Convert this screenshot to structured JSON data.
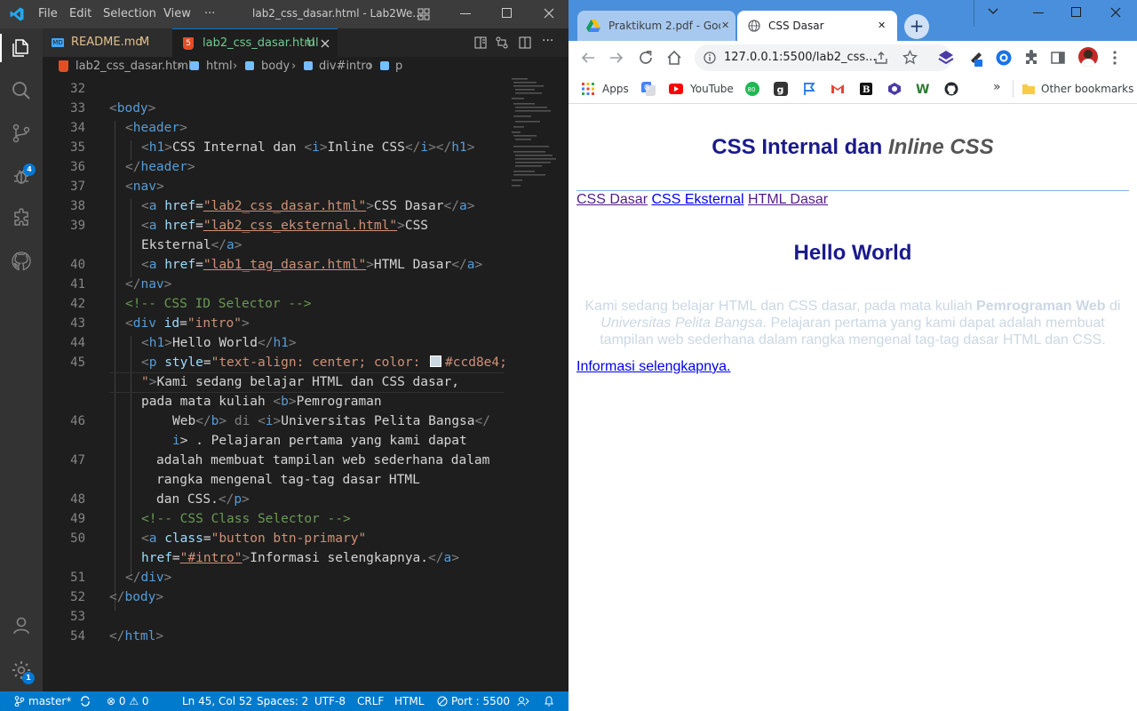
{
  "vscode": {
    "menu": [
      "File",
      "Edit",
      "Selection",
      "View",
      "···"
    ],
    "window_title": "lab2_css_dasar.html - Lab2We...",
    "tabs": [
      {
        "icon_text": "MD",
        "label": "README.md",
        "status": "M"
      },
      {
        "icon_text": "5",
        "label": "lab2_css_dasar.html",
        "status": "U"
      }
    ],
    "breadcrumb": [
      "lab2_css_dasar.html",
      "html",
      "body",
      "div#intro",
      "p"
    ],
    "line_numbers": [
      "32",
      "33",
      "34",
      "35",
      "36",
      "37",
      "38",
      "39",
      "40",
      "41",
      "42",
      "43",
      "44",
      "45",
      "46",
      "47",
      "48",
      "49",
      "50",
      "51",
      "52",
      "53",
      "54"
    ],
    "code": {
      "l33": [
        "<",
        "body",
        ">"
      ],
      "l34": [
        "<",
        "header",
        ">"
      ],
      "l35": [
        "<",
        "h1",
        ">",
        "CSS Internal dan ",
        "<",
        "i",
        ">",
        "Inline CSS",
        "</",
        "i",
        ">",
        "</",
        "h1",
        ">"
      ],
      "l36": [
        "</",
        "header",
        ">"
      ],
      "l37": [
        "<",
        "nav",
        ">"
      ],
      "l38": [
        "<",
        "a",
        " href",
        "=",
        "\"lab2_css_dasar.html\"",
        ">",
        "CSS Dasar",
        "</",
        "a",
        ">"
      ],
      "l39a": [
        "<",
        "a",
        " href",
        "=",
        "\"lab2_css_eksternal.html\"",
        ">",
        "CSS"
      ],
      "l39b": [
        "Eksternal",
        "</",
        "a",
        ">"
      ],
      "l40": [
        "<",
        "a",
        " href",
        "=",
        "\"lab1_tag_dasar.html\"",
        ">",
        "HTML Dasar",
        "</",
        "a",
        ">"
      ],
      "l41": [
        "</",
        "nav",
        ">"
      ],
      "l42": [
        "<!-- CSS ID Selector -->"
      ],
      "l43": [
        "<",
        "div",
        " id",
        "=",
        "\"intro\"",
        ">"
      ],
      "l44": [
        "<",
        "h1",
        ">",
        "Hello World",
        "</",
        "h1",
        ">"
      ],
      "l45a": [
        "<",
        "p",
        " style",
        "=",
        "\"text-align: center; color: ",
        "#ccd8e4;"
      ],
      "l45b": [
        "\"",
        ">",
        "Kami sedang belajar HTML dan CSS dasar,"
      ],
      "l45c": [
        "pada mata kuliah ",
        "<",
        "b",
        ">",
        "Pemrograman"
      ],
      "l46a": [
        "Web",
        "</",
        "b",
        "> di ",
        "<",
        "i",
        ">",
        "Universitas Pelita Bangsa",
        "</"
      ],
      "l46b": [
        "i",
        "> . Pelajaran pertama yang kami dapat"
      ],
      "l47a": [
        "adalah membuat tampilan web sederhana dalam"
      ],
      "l47b": [
        "rangka mengenal tag-tag dasar HTML"
      ],
      "l48": [
        "dan CSS.",
        "</",
        "p",
        ">"
      ],
      "l49": [
        "<!-- CSS Class Selector -->"
      ],
      "l50a": [
        "<",
        "a",
        " class",
        "=",
        "\"button btn-primary\""
      ],
      "l50b": [
        "href",
        "=",
        "\"#intro\"",
        ">",
        "Informasi selengkapnya.",
        "</",
        "a",
        ">"
      ],
      "l51": [
        "</",
        "div",
        ">"
      ],
      "l52": [
        "</",
        "body",
        ">"
      ],
      "l54": [
        "</",
        "html",
        ">"
      ]
    },
    "activity_badges": {
      "source_control": "4",
      "settings": "1"
    },
    "status": {
      "branch": "master*",
      "problems": "⊗ 0 ⚠ 0",
      "position": "Ln 45, Col 52",
      "spaces": "Spaces: 2",
      "encoding": "UTF-8",
      "eol": "CRLF",
      "language": "HTML",
      "port": "Port : 5500"
    },
    "swatch_color": "#ccd8e4"
  },
  "chrome": {
    "tabs": [
      {
        "label": "Praktikum 2.pdf - Goo",
        "close": "✕"
      },
      {
        "label": "CSS Dasar",
        "close": "✕"
      }
    ],
    "new_tab": "+",
    "url": "127.0.0.1:5500/lab2_css...",
    "bookmarks": [
      "Apps",
      "YouTube",
      "Other bookmarks"
    ],
    "bookmark_more": "»",
    "page": {
      "h1_plain": "CSS Internal dan ",
      "h1_italic": "Inline CSS",
      "nav_links": [
        "CSS Dasar",
        "CSS Eksternal",
        "HTML Dasar"
      ],
      "h2": "Hello World",
      "para_1": "Kami sedang belajar HTML dan CSS dasar, pada mata kuliah ",
      "para_bold": "Pemrograman Web",
      "para_2": " di ",
      "para_italic": "Universitas Pelita Bangsa",
      "para_3": ". Pelajaran pertama yang kami dapat adalah membuat tampilan web sederhana dalam rangka mengenal tag-tag dasar HTML dan CSS.",
      "link": "Informasi selengkapnya.",
      "heading_color": "#1a1a8c",
      "para_color": "#ccd8e4"
    }
  }
}
